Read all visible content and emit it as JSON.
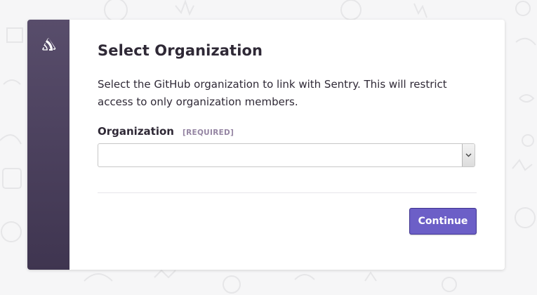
{
  "brand": {
    "logo_icon": "sentry-logo-icon",
    "sidebar_color": "#4a3f5c",
    "accent": "#6c5fc7"
  },
  "dialog": {
    "title": "Select Organization",
    "description": "Select the GitHub organization to link with Sentry. This will restrict access to only organization members.",
    "organization_label": "Organization",
    "required_tag": "[REQUIRED]",
    "organization_select": {
      "value": "",
      "arrow_icon": "chevron-down-icon"
    },
    "continue_label": "Continue"
  }
}
